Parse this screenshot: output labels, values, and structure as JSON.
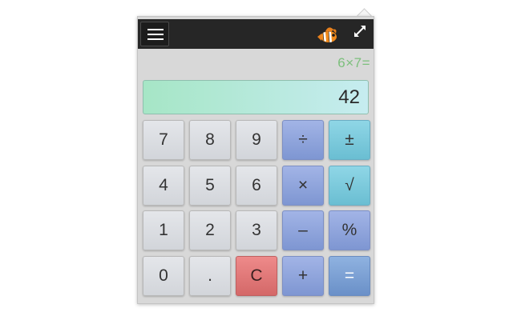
{
  "toolbar": {
    "menu_icon": "hamburger-menu-icon",
    "logo_icon": "clownfish-icon",
    "expand_icon": "expand-arrows-icon"
  },
  "display": {
    "expression": "6×7=",
    "value": "42"
  },
  "keys": [
    {
      "label": "7",
      "kind": "digit"
    },
    {
      "label": "8",
      "kind": "digit"
    },
    {
      "label": "9",
      "kind": "digit"
    },
    {
      "label": "÷",
      "kind": "operator"
    },
    {
      "label": "±",
      "kind": "function"
    },
    {
      "label": "4",
      "kind": "digit"
    },
    {
      "label": "5",
      "kind": "digit"
    },
    {
      "label": "6",
      "kind": "digit"
    },
    {
      "label": "×",
      "kind": "operator"
    },
    {
      "label": "√",
      "kind": "function"
    },
    {
      "label": "1",
      "kind": "digit"
    },
    {
      "label": "2",
      "kind": "digit"
    },
    {
      "label": "3",
      "kind": "digit"
    },
    {
      "label": "–",
      "kind": "operator"
    },
    {
      "label": "%",
      "kind": "operator"
    },
    {
      "label": "0",
      "kind": "digit"
    },
    {
      "label": ".",
      "kind": "digit"
    },
    {
      "label": "C",
      "kind": "clear"
    },
    {
      "label": "+",
      "kind": "operator"
    },
    {
      "label": "=",
      "kind": "equals"
    }
  ],
  "colors": {
    "toolbar_bg": "#262626",
    "display_gradient_start": "#a6e6c6",
    "display_gradient_end": "#c6ecf0",
    "expression_text": "#7cbf7c",
    "operator_key": "#8fa5dc",
    "function_key": "#7ccadc",
    "clear_key": "#e07878",
    "equals_key": "#7ca0d4"
  }
}
